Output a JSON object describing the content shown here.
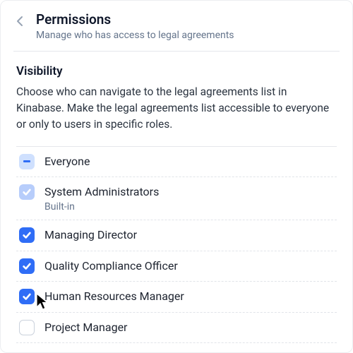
{
  "header": {
    "title": "Permissions",
    "subtitle": "Manage who has access to legal agreements"
  },
  "section": {
    "heading": "Visibility",
    "description": "Choose who can navigate to the legal agreements list in Kinabase. Make the legal agreements list accessible to everyone or only to users in specific roles."
  },
  "roles": {
    "everyone": {
      "label": "Everyone",
      "state": "indeterminate"
    },
    "sysadmin": {
      "label": "System Administrators",
      "sub": "Built-in",
      "state": "checked_disabled"
    },
    "md": {
      "label": "Managing Director",
      "state": "checked"
    },
    "qco": {
      "label": "Quality Compliance Officer",
      "state": "checked"
    },
    "hrm": {
      "label": "Human Resources Manager",
      "state": "checked"
    },
    "pm": {
      "label": "Project Manager",
      "state": "unchecked"
    }
  }
}
